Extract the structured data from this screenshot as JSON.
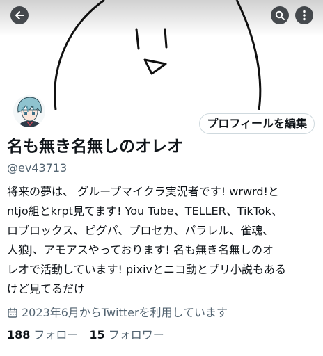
{
  "header": {
    "back_icon": "arrow-left-icon",
    "search_icon": "search-icon",
    "more_icon": "more-vertical-icon"
  },
  "profile": {
    "edit_button_label": "プロフィールを編集",
    "display_name": "名も無き名無しのオレオ",
    "handle": "@ev43713",
    "bio_lines": [
      "将来の夢は、 グループマイクラ実況者です! wrwrd!と",
      "ntjo組とkrpt見てます! You Tube、TELLER、TikTok、",
      "ロブロックス、ピグパ、プロセカ、パラレル、雀魂、",
      "人狼J、アモアスやっております! 名も無き名無しのオ",
      "レオで活動しています! pixivとニコ動とプリ小説もある",
      "けど見てるだけ"
    ],
    "joined_text": "2023年6月からTwitterを利用しています",
    "following_count": "188",
    "following_label": "フォロー",
    "followers_count": "15",
    "followers_label": "フォロワー"
  },
  "colors": {
    "primary_text": "#0f1419",
    "secondary_text": "#536471",
    "border": "#cfd9de",
    "overlay_button": "#0f1419"
  }
}
